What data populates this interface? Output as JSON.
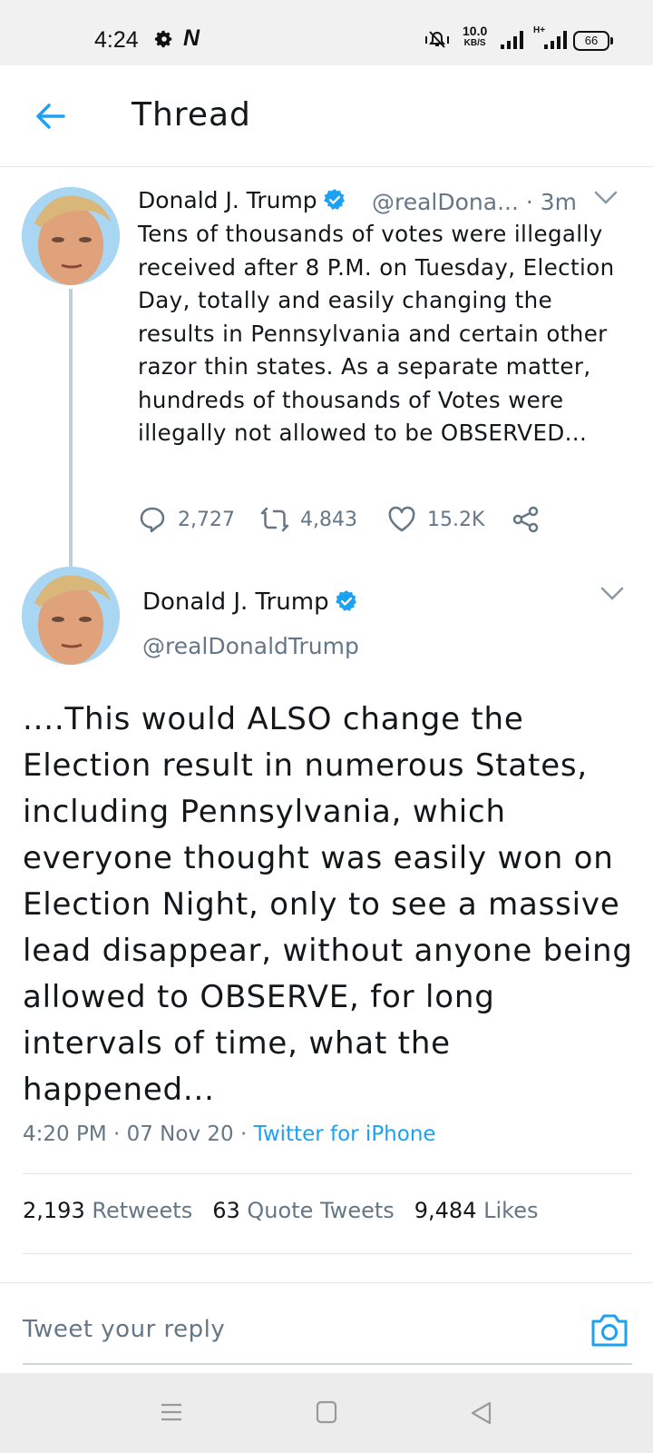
{
  "status_bar": {
    "time": "4:24",
    "network_speed": "10.0",
    "network_speed_unit": "KB/S",
    "network_type": "H+",
    "battery": "66",
    "icons": [
      "gear-icon",
      "n-notification-icon",
      "mute-icon",
      "signal-icon",
      "battery-icon"
    ]
  },
  "header": {
    "title": "Thread"
  },
  "thread_tweet": {
    "author_name": "Donald J. Trump",
    "handle_time": "@realDona... · 3m",
    "text": "Tens of thousands of votes were illegally received after 8 P.M. on Tuesday, Election Day, totally and easily changing the results in Pennsylvania and certain other razor thin states. As a separate matter, hundreds of thousands of Votes were illegally not allowed to be OBSERVED...",
    "replies": "2,727",
    "retweets": "4,843",
    "likes": "15.2K"
  },
  "main_tweet": {
    "author_name": "Donald J. Trump",
    "handle": "@realDonaldTrump",
    "text": "....This would ALSO change the Election result in numerous States, including Pennsylvania, which everyone thought was easily won on Election Night, only to see a massive lead disappear, without anyone being allowed to OBSERVE, for long intervals of time, what the happened...",
    "timestamp": "4:20 PM · 07 Nov 20 · ",
    "source": "Twitter for iPhone",
    "retweets_count": "2,193",
    "retweets_label": "Retweets",
    "quote_count": "63",
    "quote_label": "Quote Tweets",
    "likes_count": "9,484",
    "likes_label": "Likes"
  },
  "reply": {
    "placeholder": "Tweet your reply"
  },
  "colors": {
    "accent": "#1da1f2",
    "secondary_text": "#657786",
    "primary_text": "#14171a"
  }
}
